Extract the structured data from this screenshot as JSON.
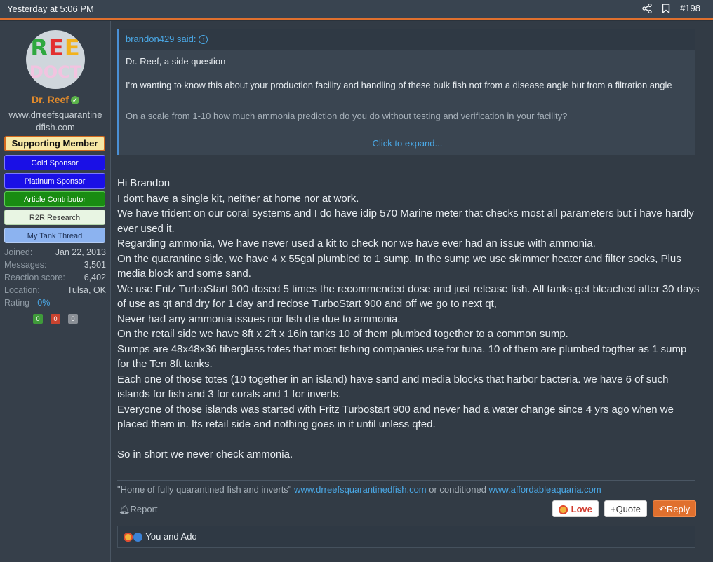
{
  "topbar": {
    "date": "Yesterday at 5:06 PM",
    "post_number": "#198",
    "icons": [
      "share-icon",
      "bookmark-icon"
    ]
  },
  "user": {
    "avatar_text_top": "REE",
    "avatar_text_bottom": "DOCT",
    "name": "Dr. Reef",
    "site_line1": "www.drreefsquarantine",
    "site_line2": "dfish.com",
    "badges": {
      "supporting": "Supporting Member",
      "gold": "Gold Sponsor",
      "platinum": "Platinum Sponsor",
      "article": "Article Contributor",
      "r2r": "R2R Research",
      "tank": "My Tank Thread"
    },
    "stats": [
      {
        "label": "Joined:",
        "value": "Jan 22, 2013"
      },
      {
        "label": "Messages:",
        "value": "3,501"
      },
      {
        "label": "Reaction score:",
        "value": "6,402"
      },
      {
        "label": "Location:",
        "value": "Tulsa, OK"
      }
    ],
    "rating_label": "Rating - ",
    "rating_value": "0%",
    "rating_counts": [
      "0",
      "0",
      "0"
    ],
    "rating_colors": [
      "#3f9b3a",
      "#c9432f",
      "#8a8f96"
    ]
  },
  "quote": {
    "author": "brandon429 said:",
    "p1": "Dr. Reef, a side question",
    "p2": "I'm wanting to know this about your production facility and handling of these bulk fish not from a disease angle but from a filtration angle",
    "p3": "On a scale from 1-10 how much ammonia prediction do you do without testing and verification in your facility?",
    "expand": "Click to expand..."
  },
  "post": {
    "lines": [
      "Hi Brandon",
      "I dont have a single kit, neither at home nor at work.",
      "We have trident on our coral systems and I do have idip 570 Marine meter that checks most all parameters but i have hardly ever used it.",
      "Regarding ammonia, We have never used a kit to check nor we have ever had an issue with ammonia.",
      "On the quarantine side, we have 4 x 55gal plumbled to 1 sump. In the sump we use skimmer heater and filter socks, Plus media block and some sand.",
      "We use Fritz TurboStart 900 dosed 5 times the recommended dose and just release fish. All tanks get bleached after 30 days of use as qt and dry for 1 day and redose TurboStart 900 and off we go to next qt,",
      "Never had any ammonia issues nor fish die due to ammonia.",
      "On the retail side we have 8ft x 2ft x 16in tanks 10 of them plumbed together to a common sump.",
      "Sumps are 48x48x36 fiberglass totes that most fishing companies use for tuna. 10 of them are plumbed togther as 1 sump for the Ten 8ft tanks.",
      "Each one of those totes (10 together in an island) have sand and media blocks that harbor bacteria. we have 6 of such islands for fish and 3 for corals and 1 for inverts.",
      "Everyone of those islands was started with Fritz Turbostart 900 and never had a water change since 4 yrs ago when we placed them in. Its retail side and nothing goes in it until unless qted.",
      "",
      "So in short we never check ammonia."
    ]
  },
  "signature": {
    "quote": "\"Home of fully quarantined fish and inverts\"",
    "link1": "www.drreefsquarantinedfish.com",
    "middle": " or conditioned ",
    "link2": "www.affordableaquaria.com"
  },
  "actions": {
    "report": "Report",
    "love": "Love",
    "quote": "Quote",
    "reply": "Reply"
  },
  "reactions": {
    "text": "You and Ado"
  },
  "colors": {
    "accent": "#e0702e",
    "link": "#4aa8e6",
    "username": "#e08a2c"
  }
}
